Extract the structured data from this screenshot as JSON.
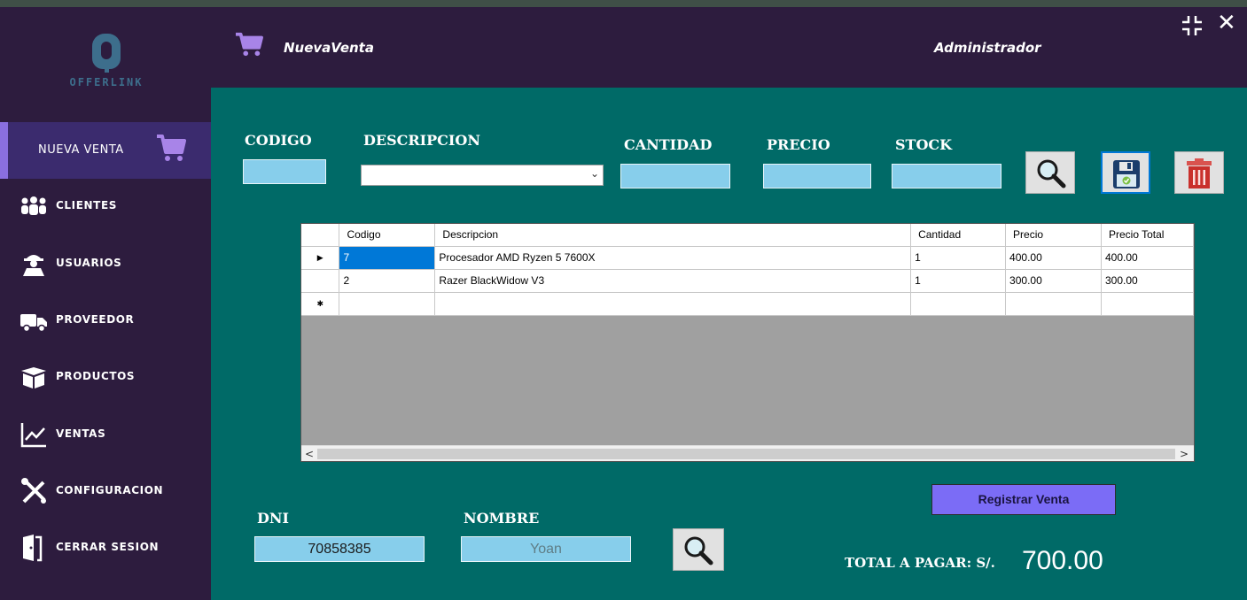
{
  "app": {
    "logo_text": "OFFERLINK",
    "title": "NuevaVenta",
    "user": "Administrador"
  },
  "sidebar": {
    "active": {
      "label": "NUEVA VENTA",
      "icon": "cart-icon"
    },
    "items": [
      {
        "label": "CLIENTES",
        "icon": "clients-icon"
      },
      {
        "label": "USUARIOS",
        "icon": "users-icon"
      },
      {
        "label": "PROVEEDOR",
        "icon": "truck-icon"
      },
      {
        "label": "PRODUCTOS",
        "icon": "box-icon"
      },
      {
        "label": "VENTAS",
        "icon": "chart-icon"
      },
      {
        "label": "CONFIGURACION",
        "icon": "tools-icon"
      },
      {
        "label": "CERRAR SESION",
        "icon": "door-icon"
      }
    ]
  },
  "form": {
    "codigo_label": "CODIGO",
    "descripcion_label": "DESCRIPCION",
    "cantidad_label": "CANTIDAD",
    "precio_label": "PRECIO",
    "stock_label": "STOCK",
    "codigo_value": "",
    "descripcion_value": "",
    "cantidad_value": "",
    "precio_value": "",
    "stock_value": ""
  },
  "grid": {
    "columns": [
      "Codigo",
      "Descripcion",
      "Cantidad",
      "Precio",
      "Precio Total"
    ],
    "rows": [
      [
        "7",
        "Procesador AMD Ryzen 5 7600X",
        "1",
        "400.00",
        "400.00"
      ],
      [
        "2",
        "Razer BlackWidow V3",
        "1",
        "300.00",
        "300.00"
      ]
    ]
  },
  "client": {
    "dni_label": "DNI",
    "dni_value": "70858385",
    "nombre_label": "NOMBRE",
    "nombre_value": "Yoan"
  },
  "actions": {
    "register_label": "Registrar Venta"
  },
  "total": {
    "label": "TOTAL A PAGAR:  S/.",
    "value": "700.00"
  },
  "colors": {
    "sidebar": "#2d1c3e",
    "main": "#006a67",
    "field": "#87ceeb",
    "accent": "#7b6cf6"
  }
}
